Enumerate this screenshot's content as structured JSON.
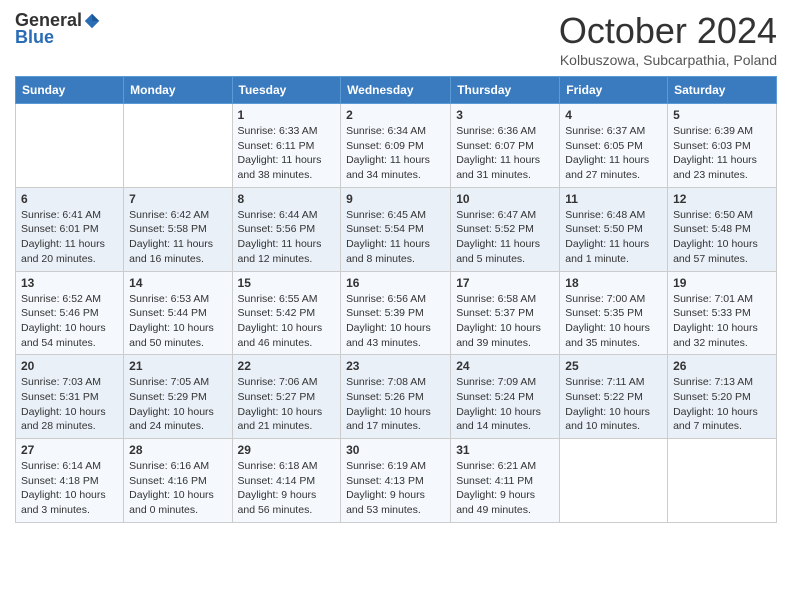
{
  "header": {
    "logo_general": "General",
    "logo_blue": "Blue",
    "month": "October 2024",
    "location": "Kolbuszowa, Subcarpathia, Poland"
  },
  "days_of_week": [
    "Sunday",
    "Monday",
    "Tuesday",
    "Wednesday",
    "Thursday",
    "Friday",
    "Saturday"
  ],
  "weeks": [
    [
      {
        "day": "",
        "info": ""
      },
      {
        "day": "",
        "info": ""
      },
      {
        "day": "1",
        "info": "Sunrise: 6:33 AM\nSunset: 6:11 PM\nDaylight: 11 hours and 38 minutes."
      },
      {
        "day": "2",
        "info": "Sunrise: 6:34 AM\nSunset: 6:09 PM\nDaylight: 11 hours and 34 minutes."
      },
      {
        "day": "3",
        "info": "Sunrise: 6:36 AM\nSunset: 6:07 PM\nDaylight: 11 hours and 31 minutes."
      },
      {
        "day": "4",
        "info": "Sunrise: 6:37 AM\nSunset: 6:05 PM\nDaylight: 11 hours and 27 minutes."
      },
      {
        "day": "5",
        "info": "Sunrise: 6:39 AM\nSunset: 6:03 PM\nDaylight: 11 hours and 23 minutes."
      }
    ],
    [
      {
        "day": "6",
        "info": "Sunrise: 6:41 AM\nSunset: 6:01 PM\nDaylight: 11 hours and 20 minutes."
      },
      {
        "day": "7",
        "info": "Sunrise: 6:42 AM\nSunset: 5:58 PM\nDaylight: 11 hours and 16 minutes."
      },
      {
        "day": "8",
        "info": "Sunrise: 6:44 AM\nSunset: 5:56 PM\nDaylight: 11 hours and 12 minutes."
      },
      {
        "day": "9",
        "info": "Sunrise: 6:45 AM\nSunset: 5:54 PM\nDaylight: 11 hours and 8 minutes."
      },
      {
        "day": "10",
        "info": "Sunrise: 6:47 AM\nSunset: 5:52 PM\nDaylight: 11 hours and 5 minutes."
      },
      {
        "day": "11",
        "info": "Sunrise: 6:48 AM\nSunset: 5:50 PM\nDaylight: 11 hours and 1 minute."
      },
      {
        "day": "12",
        "info": "Sunrise: 6:50 AM\nSunset: 5:48 PM\nDaylight: 10 hours and 57 minutes."
      }
    ],
    [
      {
        "day": "13",
        "info": "Sunrise: 6:52 AM\nSunset: 5:46 PM\nDaylight: 10 hours and 54 minutes."
      },
      {
        "day": "14",
        "info": "Sunrise: 6:53 AM\nSunset: 5:44 PM\nDaylight: 10 hours and 50 minutes."
      },
      {
        "day": "15",
        "info": "Sunrise: 6:55 AM\nSunset: 5:42 PM\nDaylight: 10 hours and 46 minutes."
      },
      {
        "day": "16",
        "info": "Sunrise: 6:56 AM\nSunset: 5:39 PM\nDaylight: 10 hours and 43 minutes."
      },
      {
        "day": "17",
        "info": "Sunrise: 6:58 AM\nSunset: 5:37 PM\nDaylight: 10 hours and 39 minutes."
      },
      {
        "day": "18",
        "info": "Sunrise: 7:00 AM\nSunset: 5:35 PM\nDaylight: 10 hours and 35 minutes."
      },
      {
        "day": "19",
        "info": "Sunrise: 7:01 AM\nSunset: 5:33 PM\nDaylight: 10 hours and 32 minutes."
      }
    ],
    [
      {
        "day": "20",
        "info": "Sunrise: 7:03 AM\nSunset: 5:31 PM\nDaylight: 10 hours and 28 minutes."
      },
      {
        "day": "21",
        "info": "Sunrise: 7:05 AM\nSunset: 5:29 PM\nDaylight: 10 hours and 24 minutes."
      },
      {
        "day": "22",
        "info": "Sunrise: 7:06 AM\nSunset: 5:27 PM\nDaylight: 10 hours and 21 minutes."
      },
      {
        "day": "23",
        "info": "Sunrise: 7:08 AM\nSunset: 5:26 PM\nDaylight: 10 hours and 17 minutes."
      },
      {
        "day": "24",
        "info": "Sunrise: 7:09 AM\nSunset: 5:24 PM\nDaylight: 10 hours and 14 minutes."
      },
      {
        "day": "25",
        "info": "Sunrise: 7:11 AM\nSunset: 5:22 PM\nDaylight: 10 hours and 10 minutes."
      },
      {
        "day": "26",
        "info": "Sunrise: 7:13 AM\nSunset: 5:20 PM\nDaylight: 10 hours and 7 minutes."
      }
    ],
    [
      {
        "day": "27",
        "info": "Sunrise: 6:14 AM\nSunset: 4:18 PM\nDaylight: 10 hours and 3 minutes."
      },
      {
        "day": "28",
        "info": "Sunrise: 6:16 AM\nSunset: 4:16 PM\nDaylight: 10 hours and 0 minutes."
      },
      {
        "day": "29",
        "info": "Sunrise: 6:18 AM\nSunset: 4:14 PM\nDaylight: 9 hours and 56 minutes."
      },
      {
        "day": "30",
        "info": "Sunrise: 6:19 AM\nSunset: 4:13 PM\nDaylight: 9 hours and 53 minutes."
      },
      {
        "day": "31",
        "info": "Sunrise: 6:21 AM\nSunset: 4:11 PM\nDaylight: 9 hours and 49 minutes."
      },
      {
        "day": "",
        "info": ""
      },
      {
        "day": "",
        "info": ""
      }
    ]
  ]
}
